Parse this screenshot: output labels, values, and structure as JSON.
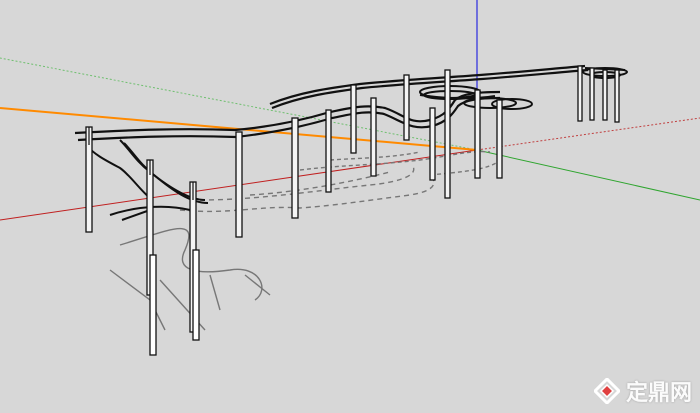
{
  "viewport": {
    "background": "#d7d7d7"
  },
  "axes": {
    "red": "#c02020",
    "green": "#2fa52f",
    "blue": "#2a2adf",
    "orange": "#ff8a00"
  },
  "watermark": {
    "text": "定鼎网",
    "logo_icon": "diamond-logo-icon",
    "color": "#ffffff"
  }
}
